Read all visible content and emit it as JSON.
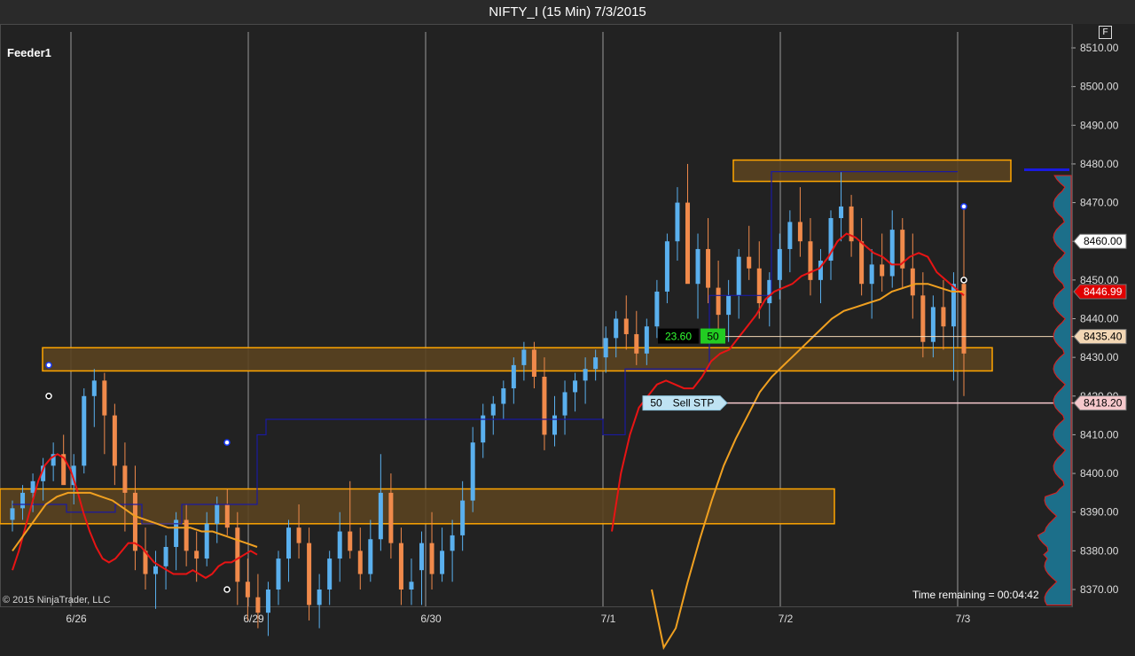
{
  "window": {
    "title": "NIFTY_I (15 Min)  7/3/2015",
    "f_button": "F"
  },
  "panel": {
    "name": "Feeder1"
  },
  "footer": {
    "copyright": "© 2015 NinjaTrader, LLC",
    "time_remaining": "Time remaining = 00:04:42"
  },
  "colors": {
    "background": "#222222",
    "up": "#5ab0ee",
    "down": "#f08a4b",
    "sma_fast": "#e81414",
    "sma_slow": "#f0a020",
    "zone_fill": "#5a4220",
    "zone_border": "#ffa500",
    "donchian": "#1a1aa0"
  },
  "chart_data": {
    "type": "candlestick",
    "instrument": "NIFTY_I",
    "interval": "15 Min",
    "x_labels": [
      "6/26",
      "6/29",
      "6/30",
      "7/1",
      "7/2",
      "7/3"
    ],
    "y_ticks": [
      "8510.00",
      "8500.00",
      "8490.00",
      "8480.00",
      "8470.00",
      "8460.00",
      "8450.00",
      "8440.00",
      "8430.00",
      "8420.00",
      "8410.00",
      "8400.00",
      "8390.00",
      "8380.00",
      "8370.00"
    ],
    "y_range": [
      8365,
      8515
    ],
    "price_markers": [
      {
        "label": "8460.00",
        "value": 8460.0,
        "bg": "#ffffff",
        "fg": "#000000"
      },
      {
        "label": "8446.99",
        "value": 8446.99,
        "bg": "#e00000",
        "fg": "#ffffff"
      },
      {
        "label": "8435.40",
        "value": 8435.4,
        "bg": "#f3d7b4",
        "fg": "#000000"
      },
      {
        "label": "8418.20",
        "value": 8418.2,
        "bg": "#f6c8cc",
        "fg": "#000000"
      }
    ],
    "position": {
      "avg_pnl": "23.60",
      "quantity": "50",
      "price": 8435.4
    },
    "stop_order": {
      "quantity": "50",
      "label": "Sell STP",
      "price": 8418.2
    },
    "zones": [
      {
        "low": 8475.5,
        "high": 8481.0,
        "start": "7/2",
        "end": "7/3+"
      },
      {
        "low": 8426.5,
        "high": 8432.5,
        "start": "6/26",
        "end": "7/3+"
      },
      {
        "low": 8387.0,
        "high": 8396.0,
        "start": "6/25",
        "end": "7/2"
      }
    ],
    "candles": [
      [
        8388,
        8393,
        8385,
        8391
      ],
      [
        8391,
        8397,
        8388,
        8395
      ],
      [
        8395,
        8400,
        8390,
        8398
      ],
      [
        8398,
        8404,
        8393,
        8402
      ],
      [
        8402,
        8408,
        8398,
        8405
      ],
      [
        8405,
        8410,
        8399,
        8397
      ],
      [
        8397,
        8405,
        8392,
        8402
      ],
      [
        8402,
        8422,
        8400,
        8420
      ],
      [
        8420,
        8427,
        8412,
        8424
      ],
      [
        8424,
        8426,
        8405,
        8415
      ],
      [
        8415,
        8418,
        8397,
        8402
      ],
      [
        8402,
        8408,
        8385,
        8395
      ],
      [
        8395,
        8402,
        8375,
        8380
      ],
      [
        8380,
        8386,
        8370,
        8374
      ],
      [
        8374,
        8380,
        8365,
        8376
      ],
      [
        8376,
        8384,
        8370,
        8381
      ],
      [
        8381,
        8390,
        8375,
        8388
      ],
      [
        8388,
        8392,
        8376,
        8380
      ],
      [
        8380,
        8385,
        8372,
        8378
      ],
      [
        8378,
        8390,
        8376,
        8387
      ],
      [
        8387,
        8394,
        8382,
        8392
      ],
      [
        8392,
        8396,
        8384,
        8386
      ],
      [
        8386,
        8390,
        8366,
        8372
      ],
      [
        8372,
        8378,
        8362,
        8368
      ],
      [
        8368,
        8374,
        8360,
        8364
      ],
      [
        8364,
        8372,
        8358,
        8370
      ],
      [
        8370,
        8380,
        8366,
        8378
      ],
      [
        8378,
        8388,
        8372,
        8386
      ],
      [
        8386,
        8392,
        8378,
        8382
      ],
      [
        8382,
        8386,
        8362,
        8366
      ],
      [
        8366,
        8374,
        8360,
        8370
      ],
      [
        8370,
        8380,
        8366,
        8378
      ],
      [
        8378,
        8390,
        8372,
        8385
      ],
      [
        8385,
        8398,
        8378,
        8380
      ],
      [
        8380,
        8386,
        8370,
        8374
      ],
      [
        8374,
        8388,
        8372,
        8383
      ],
      [
        8383,
        8405,
        8380,
        8395
      ],
      [
        8395,
        8400,
        8378,
        8382
      ],
      [
        8382,
        8386,
        8366,
        8370
      ],
      [
        8370,
        8378,
        8366,
        8372
      ],
      [
        8375,
        8385,
        8366,
        8382
      ],
      [
        8382,
        8390,
        8370,
        8374
      ],
      [
        8374,
        8386,
        8372,
        8380
      ],
      [
        8380,
        8388,
        8372,
        8384
      ],
      [
        8384,
        8398,
        8380,
        8393
      ],
      [
        8393,
        8412,
        8390,
        8408
      ],
      [
        8408,
        8418,
        8404,
        8415
      ],
      [
        8415,
        8420,
        8410,
        8418
      ],
      [
        8418,
        8424,
        8414,
        8422
      ],
      [
        8422,
        8430,
        8418,
        8428
      ],
      [
        8428,
        8434,
        8424,
        8432
      ],
      [
        8432,
        8434,
        8422,
        8425
      ],
      [
        8425,
        8430,
        8406,
        8410
      ],
      [
        8410,
        8420,
        8407,
        8415
      ],
      [
        8415,
        8424,
        8410,
        8421
      ],
      [
        8421,
        8426,
        8416,
        8424
      ],
      [
        8424,
        8430,
        8418,
        8427
      ],
      [
        8427,
        8432,
        8424,
        8430
      ],
      [
        8430,
        8438,
        8426,
        8435
      ],
      [
        8435,
        8442,
        8430,
        8440
      ],
      [
        8440,
        8446,
        8432,
        8436
      ],
      [
        8436,
        8442,
        8428,
        8431
      ],
      [
        8431,
        8440,
        8428,
        8438
      ],
      [
        8438,
        8450,
        8435,
        8447
      ],
      [
        8447,
        8462,
        8444,
        8460
      ],
      [
        8460,
        8474,
        8455,
        8470
      ],
      [
        8470,
        8480,
        8464,
        8449
      ],
      [
        8449,
        8462,
        8440,
        8458
      ],
      [
        8458,
        8466,
        8444,
        8448
      ],
      [
        8448,
        8455,
        8436,
        8441
      ],
      [
        8441,
        8450,
        8434,
        8446
      ],
      [
        8446,
        8458,
        8440,
        8456
      ],
      [
        8456,
        8464,
        8450,
        8453
      ],
      [
        8453,
        8460,
        8440,
        8444
      ],
      [
        8444,
        8452,
        8438,
        8450
      ],
      [
        8450,
        8462,
        8445,
        8458
      ],
      [
        8458,
        8468,
        8452,
        8465
      ],
      [
        8465,
        8474,
        8456,
        8460
      ],
      [
        8460,
        8466,
        8446,
        8450
      ],
      [
        8450,
        8458,
        8444,
        8455
      ],
      [
        8455,
        8468,
        8450,
        8466
      ],
      [
        8466,
        8478,
        8460,
        8469
      ],
      [
        8469,
        8472,
        8456,
        8460
      ],
      [
        8460,
        8466,
        8446,
        8449
      ],
      [
        8449,
        8458,
        8440,
        8454
      ],
      [
        8454,
        8462,
        8447,
        8451
      ],
      [
        8451,
        8468,
        8448,
        8463
      ],
      [
        8463,
        8466,
        8448,
        8453
      ],
      [
        8453,
        8462,
        8440,
        8446
      ],
      [
        8446,
        8452,
        8430,
        8434
      ],
      [
        8434,
        8446,
        8430,
        8443
      ],
      [
        8443,
        8450,
        8432,
        8438
      ],
      [
        8438,
        8452,
        8424,
        8449
      ],
      [
        8449,
        8469,
        8420,
        8431
      ]
    ],
    "sma_fast": [
      8375,
      8380,
      8386,
      8392,
      8398,
      8402,
      8404,
      8405,
      8404,
      8401,
      8396,
      8390,
      8385,
      8381,
      8378,
      8377,
      8378,
      8380,
      8382,
      8382,
      8381,
      8379,
      8377,
      8376,
      8375,
      8374,
      8374,
      8374,
      8375,
      8374,
      8373,
      8374,
      8376,
      8377,
      8377,
      8378,
      8379,
      8380,
      8379,
      8360,
      8385,
      8400,
      8410,
      8417,
      8420,
      8423,
      8424,
      8423,
      8422,
      8422,
      8425,
      8429,
      8431,
      8432,
      8435,
      8438,
      8441,
      8445,
      8447,
      8448,
      8449,
      8451,
      8452,
      8453,
      8456,
      8460,
      8462,
      8461,
      8459,
      8457,
      8456,
      8454,
      8454,
      8456,
      8457,
      8456,
      8452,
      8450,
      8448,
      8446
    ],
    "sma_slow": [
      8380,
      8384,
      8388,
      8392,
      8394,
      8395,
      8395,
      8395,
      8394,
      8393,
      8391,
      8389,
      8388,
      8387,
      8386,
      8386,
      8386,
      8385,
      8385,
      8384,
      8383,
      8382,
      8381,
      8376,
      8370,
      8355,
      8360,
      8372,
      8383,
      8393,
      8402,
      8409,
      8415,
      8421,
      8425,
      8428,
      8431,
      8434,
      8437,
      8440,
      8442,
      8443,
      8444,
      8445,
      8447,
      8448,
      8449,
      8449,
      8448,
      8447,
      8447
    ]
  }
}
